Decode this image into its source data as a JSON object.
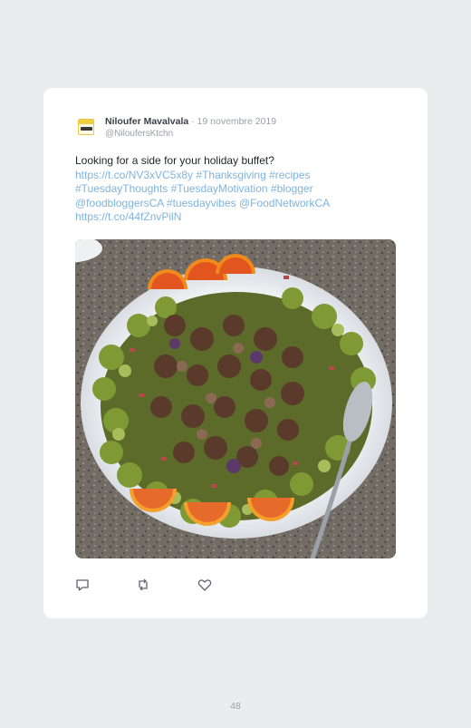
{
  "tweet": {
    "author_name": "Niloufer Mavalvala",
    "date_separator": " · ",
    "date": "19 novembre 2019",
    "handle": "@NiloufersKtchn",
    "text_lines": [
      "Looking for a side for your holiday buffet?",
      "https://t.co/NV3xVC5x8y #Thanksgiving #recipes",
      "#TuesdayThoughts #TuesdayMotivation #blogger",
      "@foodbloggersCA #tuesdayvibes @FoodNetworkCA",
      "https://t.co/44fZnvPilN"
    ]
  },
  "actions": {
    "reply_icon": "reply-icon",
    "retweet_icon": "retweet-icon",
    "like_icon": "heart-icon"
  },
  "colors": {
    "link": "#7fb3dd",
    "name": "#3a3f45",
    "muted": "#9aa0a6",
    "background": "#ebeced",
    "card": "#ffffff"
  },
  "footer": {
    "page_number": "48"
  }
}
